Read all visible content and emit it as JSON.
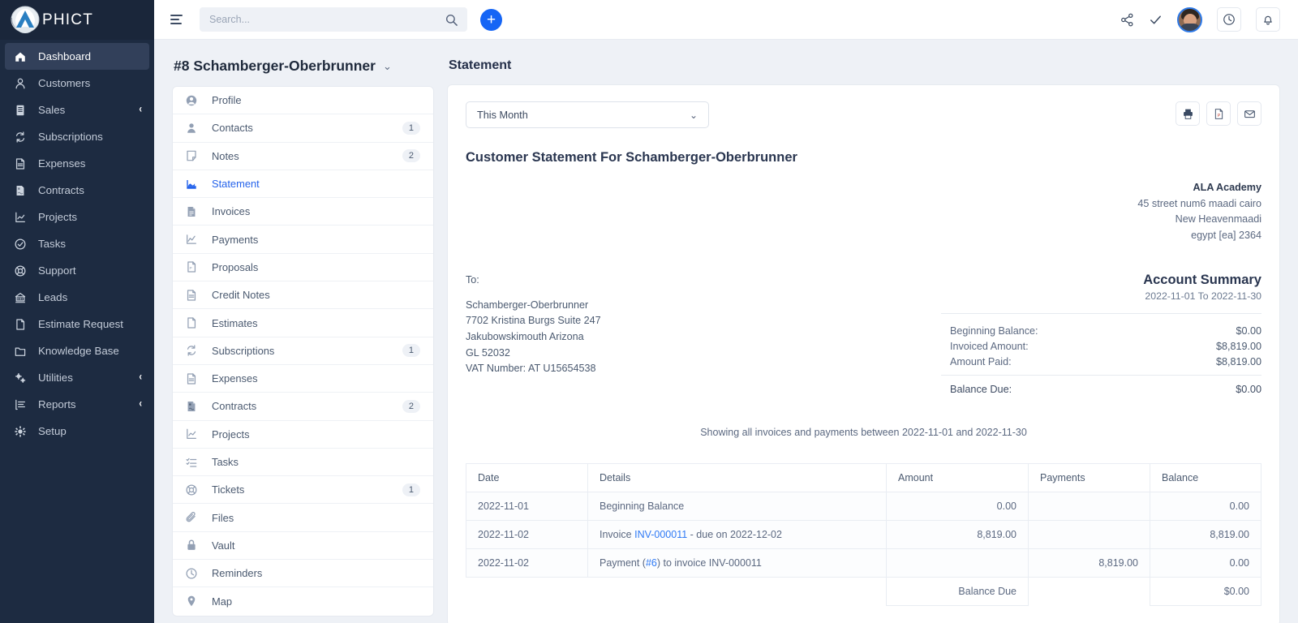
{
  "brand": {
    "name": "PHICT",
    "logo_icon": "phict-logo-icon"
  },
  "sidebar": {
    "items": [
      {
        "label": "Dashboard",
        "icon": "home-icon",
        "active": true,
        "caret": ""
      },
      {
        "label": "Customers",
        "icon": "user-icon",
        "active": false,
        "caret": ""
      },
      {
        "label": "Sales",
        "icon": "receipt-icon",
        "active": false,
        "caret": "‹"
      },
      {
        "label": "Subscriptions",
        "icon": "refresh-icon",
        "active": false,
        "caret": ""
      },
      {
        "label": "Expenses",
        "icon": "file-icon",
        "active": false,
        "caret": ""
      },
      {
        "label": "Contracts",
        "icon": "contract-icon",
        "active": false,
        "caret": ""
      },
      {
        "label": "Projects",
        "icon": "project-chart-icon",
        "active": false,
        "caret": ""
      },
      {
        "label": "Tasks",
        "icon": "check-circle-icon",
        "active": false,
        "caret": ""
      },
      {
        "label": "Support",
        "icon": "lifebuoy-icon",
        "active": false,
        "caret": ""
      },
      {
        "label": "Leads",
        "icon": "leads-icon",
        "active": false,
        "caret": ""
      },
      {
        "label": "Estimate Request",
        "icon": "document-icon",
        "active": false,
        "caret": ""
      },
      {
        "label": "Knowledge Base",
        "icon": "folder-icon",
        "active": false,
        "caret": ""
      },
      {
        "label": "Utilities",
        "icon": "gears-icon",
        "active": false,
        "caret": "‹"
      },
      {
        "label": "Reports",
        "icon": "report-list-icon",
        "active": false,
        "caret": "‹"
      },
      {
        "label": "Setup",
        "icon": "gear-icon",
        "active": false,
        "caret": ""
      }
    ]
  },
  "topbar": {
    "menu_icon": "hamburger-icon",
    "search": {
      "value": "",
      "placeholder": "Search...",
      "icon": "search-icon"
    },
    "add_label": "+",
    "icons": [
      "share-icon",
      "check-icon",
      "avatar",
      "clock-icon",
      "bell-icon"
    ]
  },
  "customer_panel": {
    "title": "#8 Schamberger-Oberbrunner",
    "title_caret": "⌄",
    "items": [
      {
        "label": "Profile",
        "icon": "profile-circle-icon",
        "badge": "",
        "active": false
      },
      {
        "label": "Contacts",
        "icon": "contacts-icon",
        "badge": "1",
        "active": false
      },
      {
        "label": "Notes",
        "icon": "note-icon",
        "badge": "2",
        "active": false
      },
      {
        "label": "Statement",
        "icon": "statement-chart-icon",
        "badge": "",
        "active": true
      },
      {
        "label": "Invoices",
        "icon": "invoice-icon",
        "badge": "",
        "active": false
      },
      {
        "label": "Payments",
        "icon": "payments-line-icon",
        "badge": "",
        "active": false
      },
      {
        "label": "Proposals",
        "icon": "proposal-icon",
        "badge": "",
        "active": false
      },
      {
        "label": "Credit Notes",
        "icon": "credit-note-icon",
        "badge": "",
        "active": false
      },
      {
        "label": "Estimates",
        "icon": "estimate-icon",
        "badge": "",
        "active": false
      },
      {
        "label": "Subscriptions",
        "icon": "refresh-icon",
        "badge": "1",
        "active": false
      },
      {
        "label": "Expenses",
        "icon": "expense-icon",
        "badge": "",
        "active": false
      },
      {
        "label": "Contracts",
        "icon": "contract-icon",
        "badge": "2",
        "active": false
      },
      {
        "label": "Projects",
        "icon": "project-chart-icon",
        "badge": "",
        "active": false
      },
      {
        "label": "Tasks",
        "icon": "task-list-icon",
        "badge": "",
        "active": false
      },
      {
        "label": "Tickets",
        "icon": "lifebuoy-icon",
        "badge": "1",
        "active": false
      },
      {
        "label": "Files",
        "icon": "paperclip-icon",
        "badge": "",
        "active": false
      },
      {
        "label": "Vault",
        "icon": "lock-icon",
        "badge": "",
        "active": false
      },
      {
        "label": "Reminders",
        "icon": "clock-icon",
        "badge": "",
        "active": false
      },
      {
        "label": "Map",
        "icon": "map-pin-icon",
        "badge": "",
        "active": false
      }
    ]
  },
  "statement": {
    "page_title": "Statement",
    "period": {
      "selected": "This Month",
      "caret": "⌄"
    },
    "tool_buttons": [
      {
        "name": "print-button",
        "icon": "printer-icon"
      },
      {
        "name": "pdf-button",
        "icon": "pdf-file-icon"
      },
      {
        "name": "email-button",
        "icon": "envelope-icon"
      }
    ],
    "title": "Customer Statement For Schamberger-Oberbrunner",
    "org": {
      "name": "ALA Academy",
      "line1": "45 street num6 maadi cairo",
      "line2": "New Heavenmaadi",
      "line3": "egypt [ea] 2364"
    },
    "to": {
      "label": "To:",
      "name": "Schamberger-Oberbrunner",
      "line1": "7702 Kristina Burgs Suite 247",
      "line2": "Jakubowskimouth Arizona",
      "line3": "GL 52032",
      "vat": "VAT Number: AT U15654538"
    },
    "summary": {
      "title": "Account Summary",
      "range": "2022-11-01 To 2022-11-30",
      "rows": [
        {
          "label": "Beginning Balance:",
          "value": "$0.00"
        },
        {
          "label": "Invoiced Amount:",
          "value": "$8,819.00"
        },
        {
          "label": "Amount Paid:",
          "value": "$8,819.00"
        }
      ],
      "total": {
        "label": "Balance Due:",
        "value": "$0.00"
      }
    },
    "showing": "Showing all invoices and payments between 2022-11-01 and 2022-11-30",
    "table": {
      "columns": [
        "Date",
        "Details",
        "Amount",
        "Payments",
        "Balance"
      ],
      "rows": [
        {
          "date": "2022-11-01",
          "details_pre": "Beginning Balance",
          "details_link": "",
          "details_post": "",
          "amount": "0.00",
          "payments": "",
          "balance": "0.00"
        },
        {
          "date": "2022-11-02",
          "details_pre": "Invoice ",
          "details_link": "INV-000011",
          "details_post": " - due on 2022-12-02",
          "amount": "8,819.00",
          "payments": "",
          "balance": "8,819.00"
        },
        {
          "date": "2022-11-02",
          "details_pre": "Payment (",
          "details_link": "#6",
          "details_post": ") to invoice INV-000011",
          "amount": "",
          "payments": "8,819.00",
          "balance": "0.00"
        }
      ],
      "footer": {
        "label": "Balance Due",
        "value": "$0.00"
      }
    }
  },
  "colors": {
    "sidebar_bg": "#1d2b41",
    "accent": "#1565f5",
    "link": "#2f7af5",
    "page_bg": "#eef1f6",
    "active_text": "#2563eb"
  }
}
